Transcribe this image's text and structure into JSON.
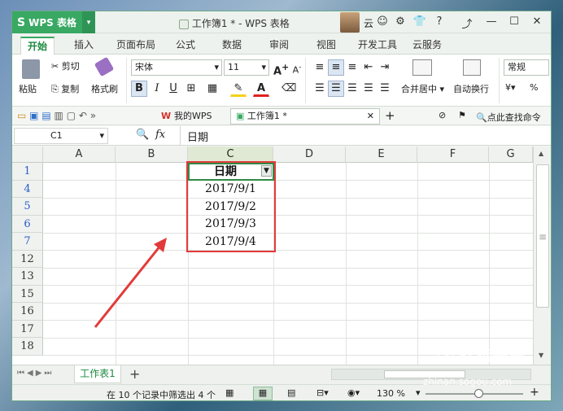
{
  "app": {
    "name": "WPS 表格",
    "window_title": "工作簿1 * - WPS 表格",
    "user_label": "云",
    "accent": "#38a863"
  },
  "ribbon_tabs": [
    "开始",
    "插入",
    "页面布局",
    "公式",
    "数据",
    "审阅",
    "视图",
    "开发工具",
    "云服务"
  ],
  "ribbon": {
    "paste": "粘贴",
    "cut": "剪切",
    "copy": "复制",
    "format_painter": "格式刷",
    "font_name": "宋体",
    "font_size": "11",
    "merge_center": "合并居中",
    "wrap_text": "自动换行",
    "number_format": "常规",
    "percent": "%",
    "bold": "B",
    "italic": "I",
    "underline": "U",
    "grow_font": "A",
    "shrink_font": "A"
  },
  "doc_tabs": {
    "wps": "我的WPS",
    "workbook": "工作簿1 *",
    "search": "点此查找命令"
  },
  "formula_bar": {
    "name_box": "C1",
    "fx": "fx",
    "content": "日期"
  },
  "grid": {
    "columns": [
      "A",
      "B",
      "C",
      "D",
      "E",
      "F",
      "G"
    ],
    "rows": [
      "1",
      "4",
      "5",
      "6",
      "7",
      "12",
      "13",
      "15",
      "16",
      "17",
      "18"
    ],
    "filter_header": "日期",
    "dates": [
      "2017/9/1",
      "2017/9/2",
      "2017/9/3",
      "2017/9/4"
    ]
  },
  "sheet_tabs": [
    "工作表1"
  ],
  "status": {
    "filter_text": "在 10 个记录中筛选出 4 个",
    "zoom": "130 %"
  },
  "watermark": {
    "brand": "搜狗指南",
    "url": "zhinan.sogou.com"
  }
}
